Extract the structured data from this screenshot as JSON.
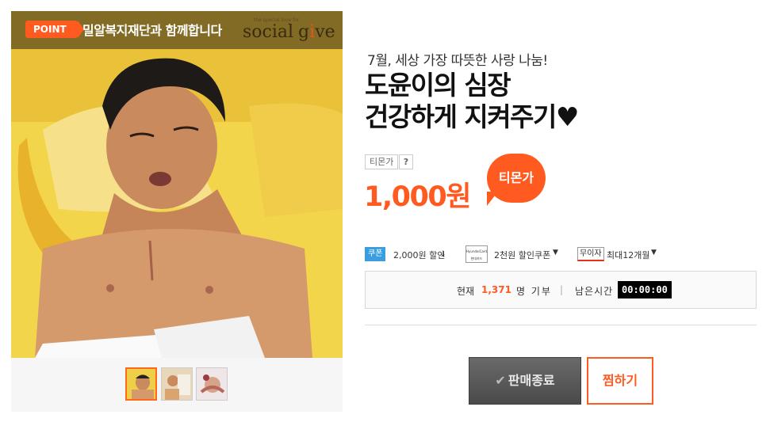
{
  "banner": {
    "point_label": "POINT",
    "partner_text": "밀알복지재단과 함께합니다",
    "logo_word1": "social",
    "logo_word2_pre": "g",
    "logo_word2_heart": "i",
    "logo_word2_post": "ve",
    "logo_sub": "the special love for"
  },
  "product": {
    "subtitle": "7월, 세상 가장 따뜻한 사랑 나눔!",
    "title_line1": "도윤이의 심장",
    "title_line2": "건강하게 지켜주기♥",
    "price_label": "티몬가",
    "help_label": "?",
    "price": "1,000원",
    "bubble_label": "티몬가"
  },
  "benefits": {
    "coupon_tag": "쿠폰",
    "coupon_text": "2,000원 할인",
    "card_label_top": "HyundaiCard",
    "card_label_bottom": "현대카드",
    "card_coupon_text": "2천원 할인쿠폰",
    "installment_tag": "무이자",
    "installment_text": "최대12개월"
  },
  "status": {
    "now_label": "현재",
    "count": "1,371",
    "unit": "명 기부",
    "separator": "|",
    "remaining_label": "남은시간",
    "timer": "00:00:00"
  },
  "actions": {
    "sold_out": "판매종료",
    "wish": "찜하기"
  },
  "colors": {
    "accent": "#ff5a1f",
    "coupon_blue": "#3a9de0"
  }
}
